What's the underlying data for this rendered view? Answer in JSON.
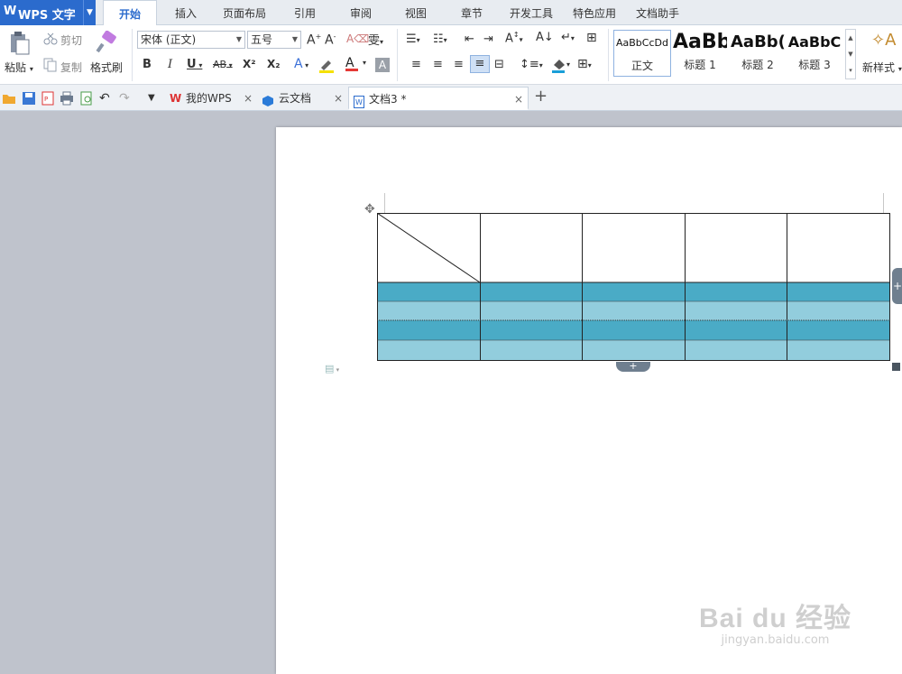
{
  "app": {
    "logo": "W",
    "title": "WPS 文字"
  },
  "menu_tabs": [
    "开始",
    "插入",
    "页面布局",
    "引用",
    "审阅",
    "视图",
    "章节",
    "开发工具",
    "特色应用",
    "文档助手"
  ],
  "ribbon": {
    "paste_label": "粘贴",
    "cut_label": "剪切",
    "copy_label": "复制",
    "format_painter_label": "格式刷",
    "font_name": "宋体 (正文)",
    "font_size": "五号",
    "bold": "B",
    "italic": "I",
    "underline": "U",
    "strike": "AB",
    "superscript": "X²",
    "subscript": "X₂",
    "styles": [
      {
        "sample": "AaBbCcDd",
        "name": "正文"
      },
      {
        "sample": "AaBb",
        "name": "标题 1"
      },
      {
        "sample": "AaBb(",
        "name": "标题 2"
      },
      {
        "sample": "AaBbC",
        "name": "标题 3"
      }
    ],
    "new_style_label": "新样式"
  },
  "doc_tabs": [
    {
      "label": "我的WPS"
    },
    {
      "label": "云文档"
    },
    {
      "label": "文档3 *"
    }
  ],
  "table": {
    "header_cells": 5,
    "data_rows": 4,
    "band_dark": "#4aabc6",
    "band_light": "#92cddd"
  },
  "watermark": {
    "main": "Bai du 经验",
    "sub": "jingyan.baidu.com"
  },
  "colors": {
    "accent": "#2b6bcd",
    "font_color": "#e53935",
    "highlight": "#f5e100"
  }
}
